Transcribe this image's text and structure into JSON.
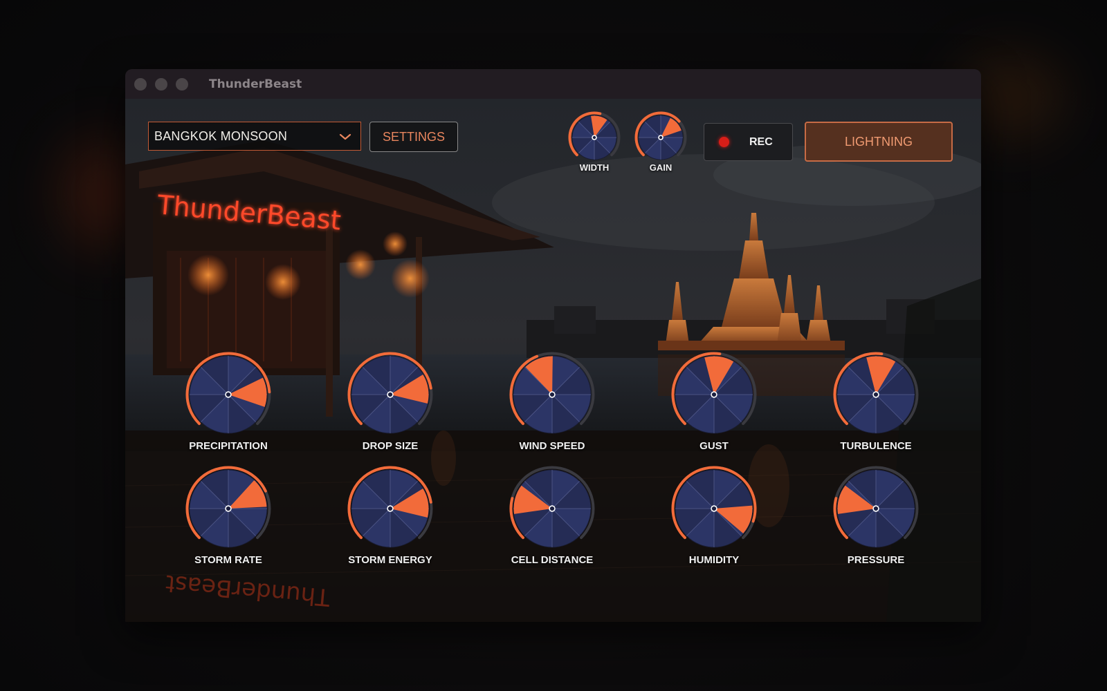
{
  "window": {
    "title": "ThunderBeast"
  },
  "header": {
    "preset": {
      "label": "BANGKOK MONSOON"
    },
    "settings_label": "SETTINGS",
    "rec_label": "REC",
    "lightning_label": "LIGHTNING"
  },
  "background": {
    "neon_sign": "ThunderBeast"
  },
  "small_knobs": [
    {
      "label": "WIDTH",
      "value": 0.55
    },
    {
      "label": "GAIN",
      "value": 0.68
    }
  ],
  "knobs": [
    {
      "label": "PRECIPITATION",
      "value": 0.82
    },
    {
      "label": "DROP SIZE",
      "value": 0.8
    },
    {
      "label": "WIND SPEED",
      "value": 0.42
    },
    {
      "label": "GUST",
      "value": 0.53
    },
    {
      "label": "TURBULENCE",
      "value": 0.53
    },
    {
      "label": "STORM RATE",
      "value": 0.74
    },
    {
      "label": "STORM ENERGY",
      "value": 0.8
    },
    {
      "label": "CELL DISTANCE",
      "value": 0.22
    },
    {
      "label": "HUMIDITY",
      "value": 0.9
    },
    {
      "label": "PRESSURE",
      "value": 0.22
    }
  ],
  "colors": {
    "accent": "#f26b3a",
    "knob_face": "#2c3566",
    "knob_face_alt": "#252c55",
    "rec": "#d81e18",
    "lightning_bg": "#55301f"
  }
}
